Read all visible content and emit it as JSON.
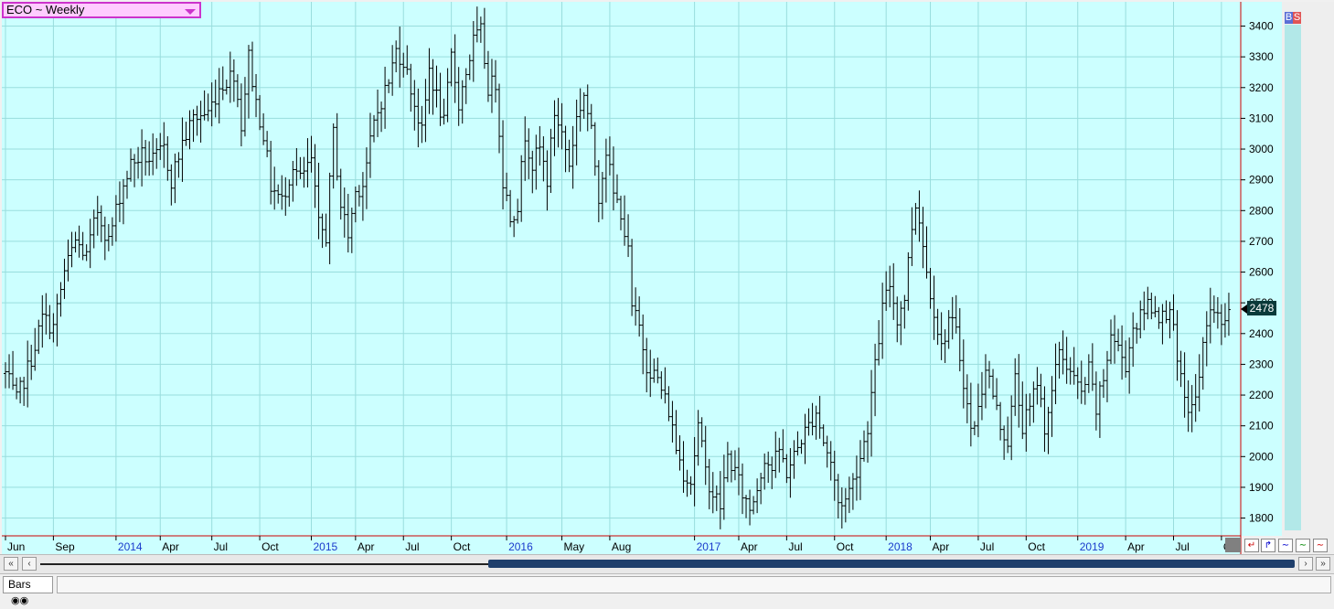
{
  "symbol": {
    "label": "ECO ~ Weekly"
  },
  "badges": {
    "buy": "B",
    "sell": "S"
  },
  "status": {
    "tab_label": "Bars"
  },
  "price_tag": "2478",
  "colors": {
    "plot_bg": "#ccffff",
    "grid": "#99dddd",
    "bar": "#000000",
    "axis_line": "#cc0000",
    "year_label": "#1a3acc"
  },
  "chart_data": {
    "type": "ohlc",
    "title": "ECO ~ Weekly",
    "ylim": [
      1760,
      3470
    ],
    "y_ticks": [
      1800,
      1900,
      2000,
      2100,
      2200,
      2300,
      2400,
      2500,
      2600,
      2700,
      2800,
      2900,
      3000,
      3100,
      3200,
      3300,
      3400
    ],
    "x_ticks": [
      {
        "label": "Jun",
        "t": 0,
        "year": false
      },
      {
        "label": "Sep",
        "t": 13,
        "year": false
      },
      {
        "label": "2014",
        "t": 30,
        "year": true
      },
      {
        "label": "Apr",
        "t": 42,
        "year": false
      },
      {
        "label": "Jul",
        "t": 56,
        "year": false
      },
      {
        "label": "Oct",
        "t": 69,
        "year": false
      },
      {
        "label": "2015",
        "t": 83,
        "year": true
      },
      {
        "label": "Apr",
        "t": 95,
        "year": false
      },
      {
        "label": "Jul",
        "t": 108,
        "year": false
      },
      {
        "label": "Oct",
        "t": 121,
        "year": false
      },
      {
        "label": "2016",
        "t": 136,
        "year": true
      },
      {
        "label": "May",
        "t": 151,
        "year": false
      },
      {
        "label": "Aug",
        "t": 164,
        "year": false
      },
      {
        "label": "2017",
        "t": 187,
        "year": true
      },
      {
        "label": "Apr",
        "t": 199,
        "year": false
      },
      {
        "label": "Jul",
        "t": 212,
        "year": false
      },
      {
        "label": "Oct",
        "t": 225,
        "year": false
      },
      {
        "label": "2018",
        "t": 239,
        "year": true
      },
      {
        "label": "Apr",
        "t": 251,
        "year": false
      },
      {
        "label": "Jul",
        "t": 264,
        "year": false
      },
      {
        "label": "Oct",
        "t": 277,
        "year": false
      },
      {
        "label": "2019",
        "t": 291,
        "year": true
      },
      {
        "label": "Apr",
        "t": 304,
        "year": false
      },
      {
        "label": "Jul",
        "t": 317,
        "year": false
      },
      {
        "label": "Oct",
        "t": 330,
        "year": false
      }
    ],
    "key_closes": [
      [
        0,
        2270
      ],
      [
        3,
        2180
      ],
      [
        7,
        2320
      ],
      [
        10,
        2450
      ],
      [
        13,
        2420
      ],
      [
        16,
        2600
      ],
      [
        19,
        2700
      ],
      [
        22,
        2650
      ],
      [
        25,
        2800
      ],
      [
        28,
        2700
      ],
      [
        31,
        2850
      ],
      [
        34,
        2950
      ],
      [
        37,
        2980
      ],
      [
        40,
        2960
      ],
      [
        43,
        3000
      ],
      [
        45,
        2900
      ],
      [
        48,
        3020
      ],
      [
        51,
        3100
      ],
      [
        55,
        3120
      ],
      [
        58,
        3200
      ],
      [
        62,
        3250
      ],
      [
        64,
        3080
      ],
      [
        66,
        3300
      ],
      [
        68,
        3150
      ],
      [
        70,
        3050
      ],
      [
        72,
        2880
      ],
      [
        75,
        2830
      ],
      [
        78,
        2950
      ],
      [
        80,
        2900
      ],
      [
        83,
        2960
      ],
      [
        85,
        2750
      ],
      [
        87,
        2720
      ],
      [
        89,
        3050
      ],
      [
        91,
        2820
      ],
      [
        93,
        2720
      ],
      [
        95,
        2860
      ],
      [
        97,
        2890
      ],
      [
        100,
        3080
      ],
      [
        102,
        3160
      ],
      [
        104,
        3220
      ],
      [
        106,
        3320
      ],
      [
        108,
        3290
      ],
      [
        111,
        3150
      ],
      [
        113,
        3050
      ],
      [
        115,
        3260
      ],
      [
        117,
        3170
      ],
      [
        119,
        3080
      ],
      [
        121,
        3300
      ],
      [
        123,
        3150
      ],
      [
        125,
        3250
      ],
      [
        127,
        3350
      ],
      [
        129,
        3380
      ],
      [
        131,
        3200
      ],
      [
        133,
        3220
      ],
      [
        135,
        2900
      ],
      [
        137,
        2780
      ],
      [
        139,
        2820
      ],
      [
        141,
        3050
      ],
      [
        143,
        2950
      ],
      [
        145,
        3000
      ],
      [
        147,
        2900
      ],
      [
        149,
        3120
      ],
      [
        151,
        3050
      ],
      [
        153,
        2950
      ],
      [
        155,
        3100
      ],
      [
        157,
        3180
      ],
      [
        159,
        3050
      ],
      [
        161,
        2850
      ],
      [
        163,
        3000
      ],
      [
        165,
        2850
      ],
      [
        167,
        2800
      ],
      [
        169,
        2660
      ],
      [
        170,
        2480
      ],
      [
        172,
        2420
      ],
      [
        174,
        2300
      ],
      [
        177,
        2250
      ],
      [
        180,
        2150
      ],
      [
        182,
        2030
      ],
      [
        184,
        1950
      ],
      [
        186,
        1920
      ],
      [
        188,
        2100
      ],
      [
        190,
        1950
      ],
      [
        192,
        1880
      ],
      [
        194,
        1840
      ],
      [
        196,
        2000
      ],
      [
        198,
        1950
      ],
      [
        200,
        1880
      ],
      [
        202,
        1830
      ],
      [
        204,
        1900
      ],
      [
        206,
        2000
      ],
      [
        208,
        1960
      ],
      [
        210,
        2020
      ],
      [
        212,
        1950
      ],
      [
        214,
        2000
      ],
      [
        216,
        2060
      ],
      [
        218,
        2100
      ],
      [
        220,
        2150
      ],
      [
        222,
        2050
      ],
      [
        224,
        1980
      ],
      [
        226,
        1850
      ],
      [
        228,
        1860
      ],
      [
        230,
        1920
      ],
      [
        232,
        2000
      ],
      [
        234,
        2100
      ],
      [
        235,
        2200
      ],
      [
        236,
        2290
      ],
      [
        238,
        2480
      ],
      [
        240,
        2560
      ],
      [
        242,
        2450
      ],
      [
        244,
        2520
      ],
      [
        246,
        2750
      ],
      [
        247,
        2820
      ],
      [
        248,
        2780
      ],
      [
        250,
        2600
      ],
      [
        252,
        2480
      ],
      [
        254,
        2350
      ],
      [
        256,
        2450
      ],
      [
        258,
        2400
      ],
      [
        260,
        2250
      ],
      [
        262,
        2080
      ],
      [
        264,
        2150
      ],
      [
        266,
        2300
      ],
      [
        268,
        2200
      ],
      [
        270,
        2100
      ],
      [
        272,
        2050
      ],
      [
        274,
        2250
      ],
      [
        276,
        2100
      ],
      [
        278,
        2150
      ],
      [
        280,
        2250
      ],
      [
        282,
        2100
      ],
      [
        284,
        2200
      ],
      [
        286,
        2350
      ],
      [
        288,
        2300
      ],
      [
        290,
        2250
      ],
      [
        292,
        2200
      ],
      [
        294,
        2280
      ],
      [
        296,
        2150
      ],
      [
        298,
        2250
      ],
      [
        300,
        2400
      ],
      [
        302,
        2350
      ],
      [
        304,
        2300
      ],
      [
        306,
        2420
      ],
      [
        308,
        2450
      ],
      [
        310,
        2500
      ],
      [
        312,
        2480
      ],
      [
        314,
        2450
      ],
      [
        316,
        2500
      ],
      [
        318,
        2300
      ],
      [
        320,
        2180
      ],
      [
        322,
        2150
      ],
      [
        324,
        2250
      ],
      [
        326,
        2450
      ],
      [
        328,
        2480
      ],
      [
        330,
        2420
      ],
      [
        332,
        2478
      ]
    ]
  }
}
